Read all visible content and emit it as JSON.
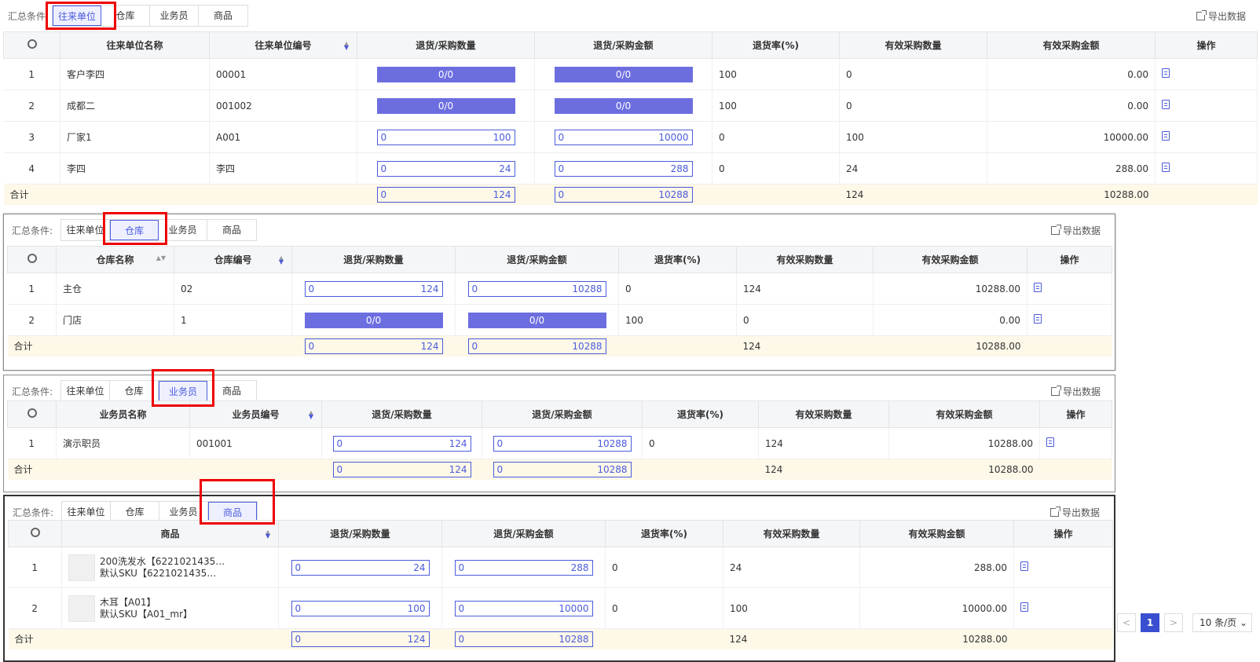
{
  "common": {
    "cond_label": "汇总条件:",
    "export": "导出数据",
    "total": "合计",
    "tabs": [
      "往来单位",
      "仓库",
      "业务员",
      "商品"
    ]
  },
  "p1": {
    "headers": [
      "往来单位名称",
      "往来单位编号",
      "退货/采购数量",
      "退货/采购金额",
      "退货率(%)",
      "有效采购数量",
      "有效采购金额",
      "操作"
    ],
    "rows": [
      {
        "idx": "1",
        "name": "客户李四",
        "code": "00001",
        "qty": "0/0",
        "amt": "0/0",
        "rate": "100",
        "eq": "0",
        "ea": "0.00"
      },
      {
        "idx": "2",
        "name": "成都二",
        "code": "001002",
        "qty": "0/0",
        "amt": "0/0",
        "rate": "100",
        "eq": "0",
        "ea": "0.00"
      },
      {
        "idx": "3",
        "name": "厂家1",
        "code": "A001",
        "qa": "0",
        "qb": "100",
        "aa": "0",
        "ab": "10000",
        "rate": "0",
        "eq": "100",
        "ea": "10000.00"
      },
      {
        "idx": "4",
        "name": "李四",
        "code": "李四",
        "qa": "0",
        "qb": "24",
        "aa": "0",
        "ab": "288",
        "rate": "0",
        "eq": "24",
        "ea": "288.00"
      }
    ],
    "total": {
      "qa": "0",
      "qb": "124",
      "aa": "0",
      "ab": "10288",
      "eq": "124",
      "ea": "10288.00"
    }
  },
  "p2": {
    "headers": [
      "仓库名称",
      "仓库编号",
      "退货/采购数量",
      "退货/采购金额",
      "退货率(%)",
      "有效采购数量",
      "有效采购金额",
      "操作"
    ],
    "rows": [
      {
        "idx": "1",
        "name": "主仓",
        "code": "02",
        "qa": "0",
        "qb": "124",
        "aa": "0",
        "ab": "10288",
        "rate": "0",
        "eq": "124",
        "ea": "10288.00"
      },
      {
        "idx": "2",
        "name": "门店",
        "code": "1",
        "qty": "0/0",
        "amt": "0/0",
        "rate": "100",
        "eq": "0",
        "ea": "0.00"
      }
    ],
    "total": {
      "qa": "0",
      "qb": "124",
      "aa": "0",
      "ab": "10288",
      "eq": "124",
      "ea": "10288.00"
    }
  },
  "p3": {
    "headers": [
      "业务员名称",
      "业务员编号",
      "退货/采购数量",
      "退货/采购金额",
      "退货率(%)",
      "有效采购数量",
      "有效采购金额",
      "操作"
    ],
    "rows": [
      {
        "idx": "1",
        "name": "演示职员",
        "code": "001001",
        "qa": "0",
        "qb": "124",
        "aa": "0",
        "ab": "10288",
        "rate": "0",
        "eq": "124",
        "ea": "10288.00"
      }
    ],
    "total": {
      "qa": "0",
      "qb": "124",
      "aa": "0",
      "ab": "10288",
      "eq": "124",
      "ea": "10288.00"
    }
  },
  "p4": {
    "headers": [
      "商品",
      "退货/采购数量",
      "退货/采购金额",
      "退货率(%)",
      "有效采购数量",
      "有效采购金额",
      "操作"
    ],
    "rows": [
      {
        "idx": "1",
        "line1": "200洗发水【6221021435…",
        "line2": "默认SKU【6221021435…",
        "qa": "0",
        "qb": "24",
        "aa": "0",
        "ab": "288",
        "rate": "0",
        "eq": "24",
        "ea": "288.00"
      },
      {
        "idx": "2",
        "line1": "木耳【A01】",
        "line2": "默认SKU【A01_mr】",
        "qa": "0",
        "qb": "100",
        "aa": "0",
        "ab": "10000",
        "rate": "0",
        "eq": "100",
        "ea": "10000.00"
      }
    ],
    "total": {
      "qa": "0",
      "qb": "124",
      "aa": "0",
      "ab": "10288",
      "eq": "124",
      "ea": "10288.00"
    }
  },
  "pager": {
    "prev": "<",
    "page": "1",
    "next": ">",
    "size": "10 条/页 ⌄"
  },
  "colors": {
    "accent": "#4b5bdc",
    "progress": "#6c6ee0",
    "highlight": "#ee0000",
    "total_bg": "#fdf8e8"
  }
}
